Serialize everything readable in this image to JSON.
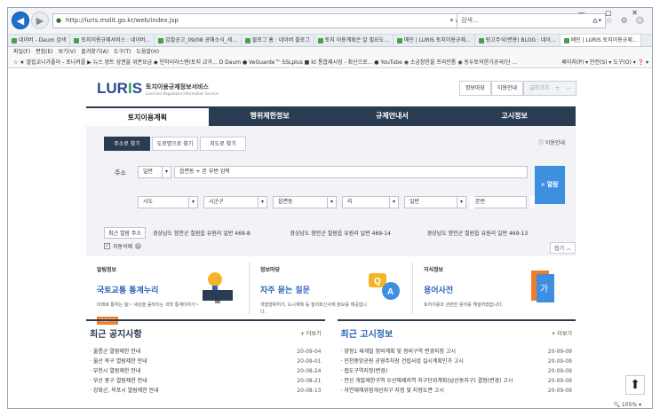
{
  "browser": {
    "url": "http://luris.molit.go.kr/web/index.jsp",
    "search_placeholder": "검색...",
    "tabs": [
      "네이버 - Daum 검색",
      "토지이용규제서비스 : 네이버...",
      "입찰공고_09/08 공매소식_세...",
      "블로그 홈 : 네이버 블로그",
      "토지 이용계획은 알 필요도...",
      "메인 | LURIS 토지이용규제...",
      "링고주식(변용) BLOG : 네이...",
      "메인 | LURIS 토지이용규제..."
    ],
    "active_tab": 7,
    "menus": "파일(F) 편집(E) 보기(V) 즐겨찾기(A) 도구(T) 도움말(H)",
    "favorites": "☆ ★ 말립교니가좋아 - 포나커플  ▶ 뉴스 쌍트 상권을 위폰요금  ◆ 인하이라스탠(토지 교가...  D Daum ● VeGuarde™ SSLplus ■ kt 통합제시징 - 최신으로...  ● YouTube ◉ 소금창한을 프라인통  ◉ 동두토의한기공국(단 ...",
    "favorites_right": "페이지(P) ▾  안전(S) ▾  도구(O) ▾  ❓ ▾"
  },
  "site": {
    "logo": "LURIS",
    "logo_title": "토지이용규제정보서비스",
    "logo_sub": "Land Use Regulation Information Service",
    "top_buttons": [
      "정보마당",
      "이용안내"
    ],
    "zoom_label": "글자크기",
    "gnb": [
      "토지이용계획",
      "행위제한정보",
      "규제안내서",
      "고시정보"
    ],
    "search_tabs": [
      "주소로 찾기",
      "도로명으로 찾기",
      "지도로 찾기"
    ],
    "help": "이용안내",
    "address_label": "주소",
    "lot_type": "일반",
    "address_input": "읍면동 + 본 부번 입력",
    "selects": [
      "시도",
      "시군구",
      "읍면동",
      "리",
      "일반"
    ],
    "bonbun": "본번",
    "bubun": "부번",
    "search_btn": "열람",
    "recent_label": "최근 열람 주소",
    "recent": [
      "경상남도 함안군 칠원읍 유원리 일반 469-8",
      "경상남도 함안군 칠원읍 유원리 일반 469-14",
      "경상남도 함안군 칠원읍 유원리 일반 469-13"
    ],
    "autosave": "자동삭제",
    "fold": "접기 ︿",
    "info": [
      {
        "cat": "알림정보",
        "title": "국토교통 통계누리",
        "desc": "미래로 통하는 窓~ 세상을 움직이는 과학 통계이야기~",
        "go": "바로가기"
      },
      {
        "cat": "정보마당",
        "title": "자주 묻는 질문",
        "desc": "개발행위허가, 도시계획 등 질의회신사례 정보를 제공합니다.",
        "go": ""
      },
      {
        "cat": "지식정보",
        "title": "용어사전",
        "desc": "토지이용과 관련한 용어를 해설하였습니다.",
        "go": ""
      }
    ],
    "notice": {
      "title": "최근 공지사항",
      "more": "+ 더보기",
      "items": [
        {
          "t": "울릉군 열람제한 안내",
          "d": "20-09-04"
        },
        {
          "t": "울산 북구 열람제한 안내",
          "d": "20-09-01"
        },
        {
          "t": "부천시 열람제한 안내",
          "d": "20-08-24"
        },
        {
          "t": "부산 중구 열람제한 안내",
          "d": "20-08-21"
        },
        {
          "t": "강화군, 옥포시 열람제한 안내",
          "d": "20-08-13"
        }
      ]
    },
    "gosi": {
      "title": "최근 고시정보",
      "more": "+ 더보기",
      "items": [
        {
          "t": "양정1 재개발 정비계획 및 정비구역 변경지정 고시",
          "d": "20-09-09"
        },
        {
          "t": "인천중앙공원 공영주차장 건립사업 실시계획인가 고시",
          "d": "20-09-09"
        },
        {
          "t": "접도구역지정(변경)",
          "d": "20-09-09"
        },
        {
          "t": "안산 개발제한구역 우선해제지역 지구단위계획(남산동지구) 결정(변경) 고시",
          "d": "20-09-09"
        },
        {
          "t": "자연재해위험개선지구 지정 및 지형도면 고시",
          "d": "20-09-09"
        }
      ]
    },
    "zoom_indicator": "🔍 105% ▾"
  }
}
